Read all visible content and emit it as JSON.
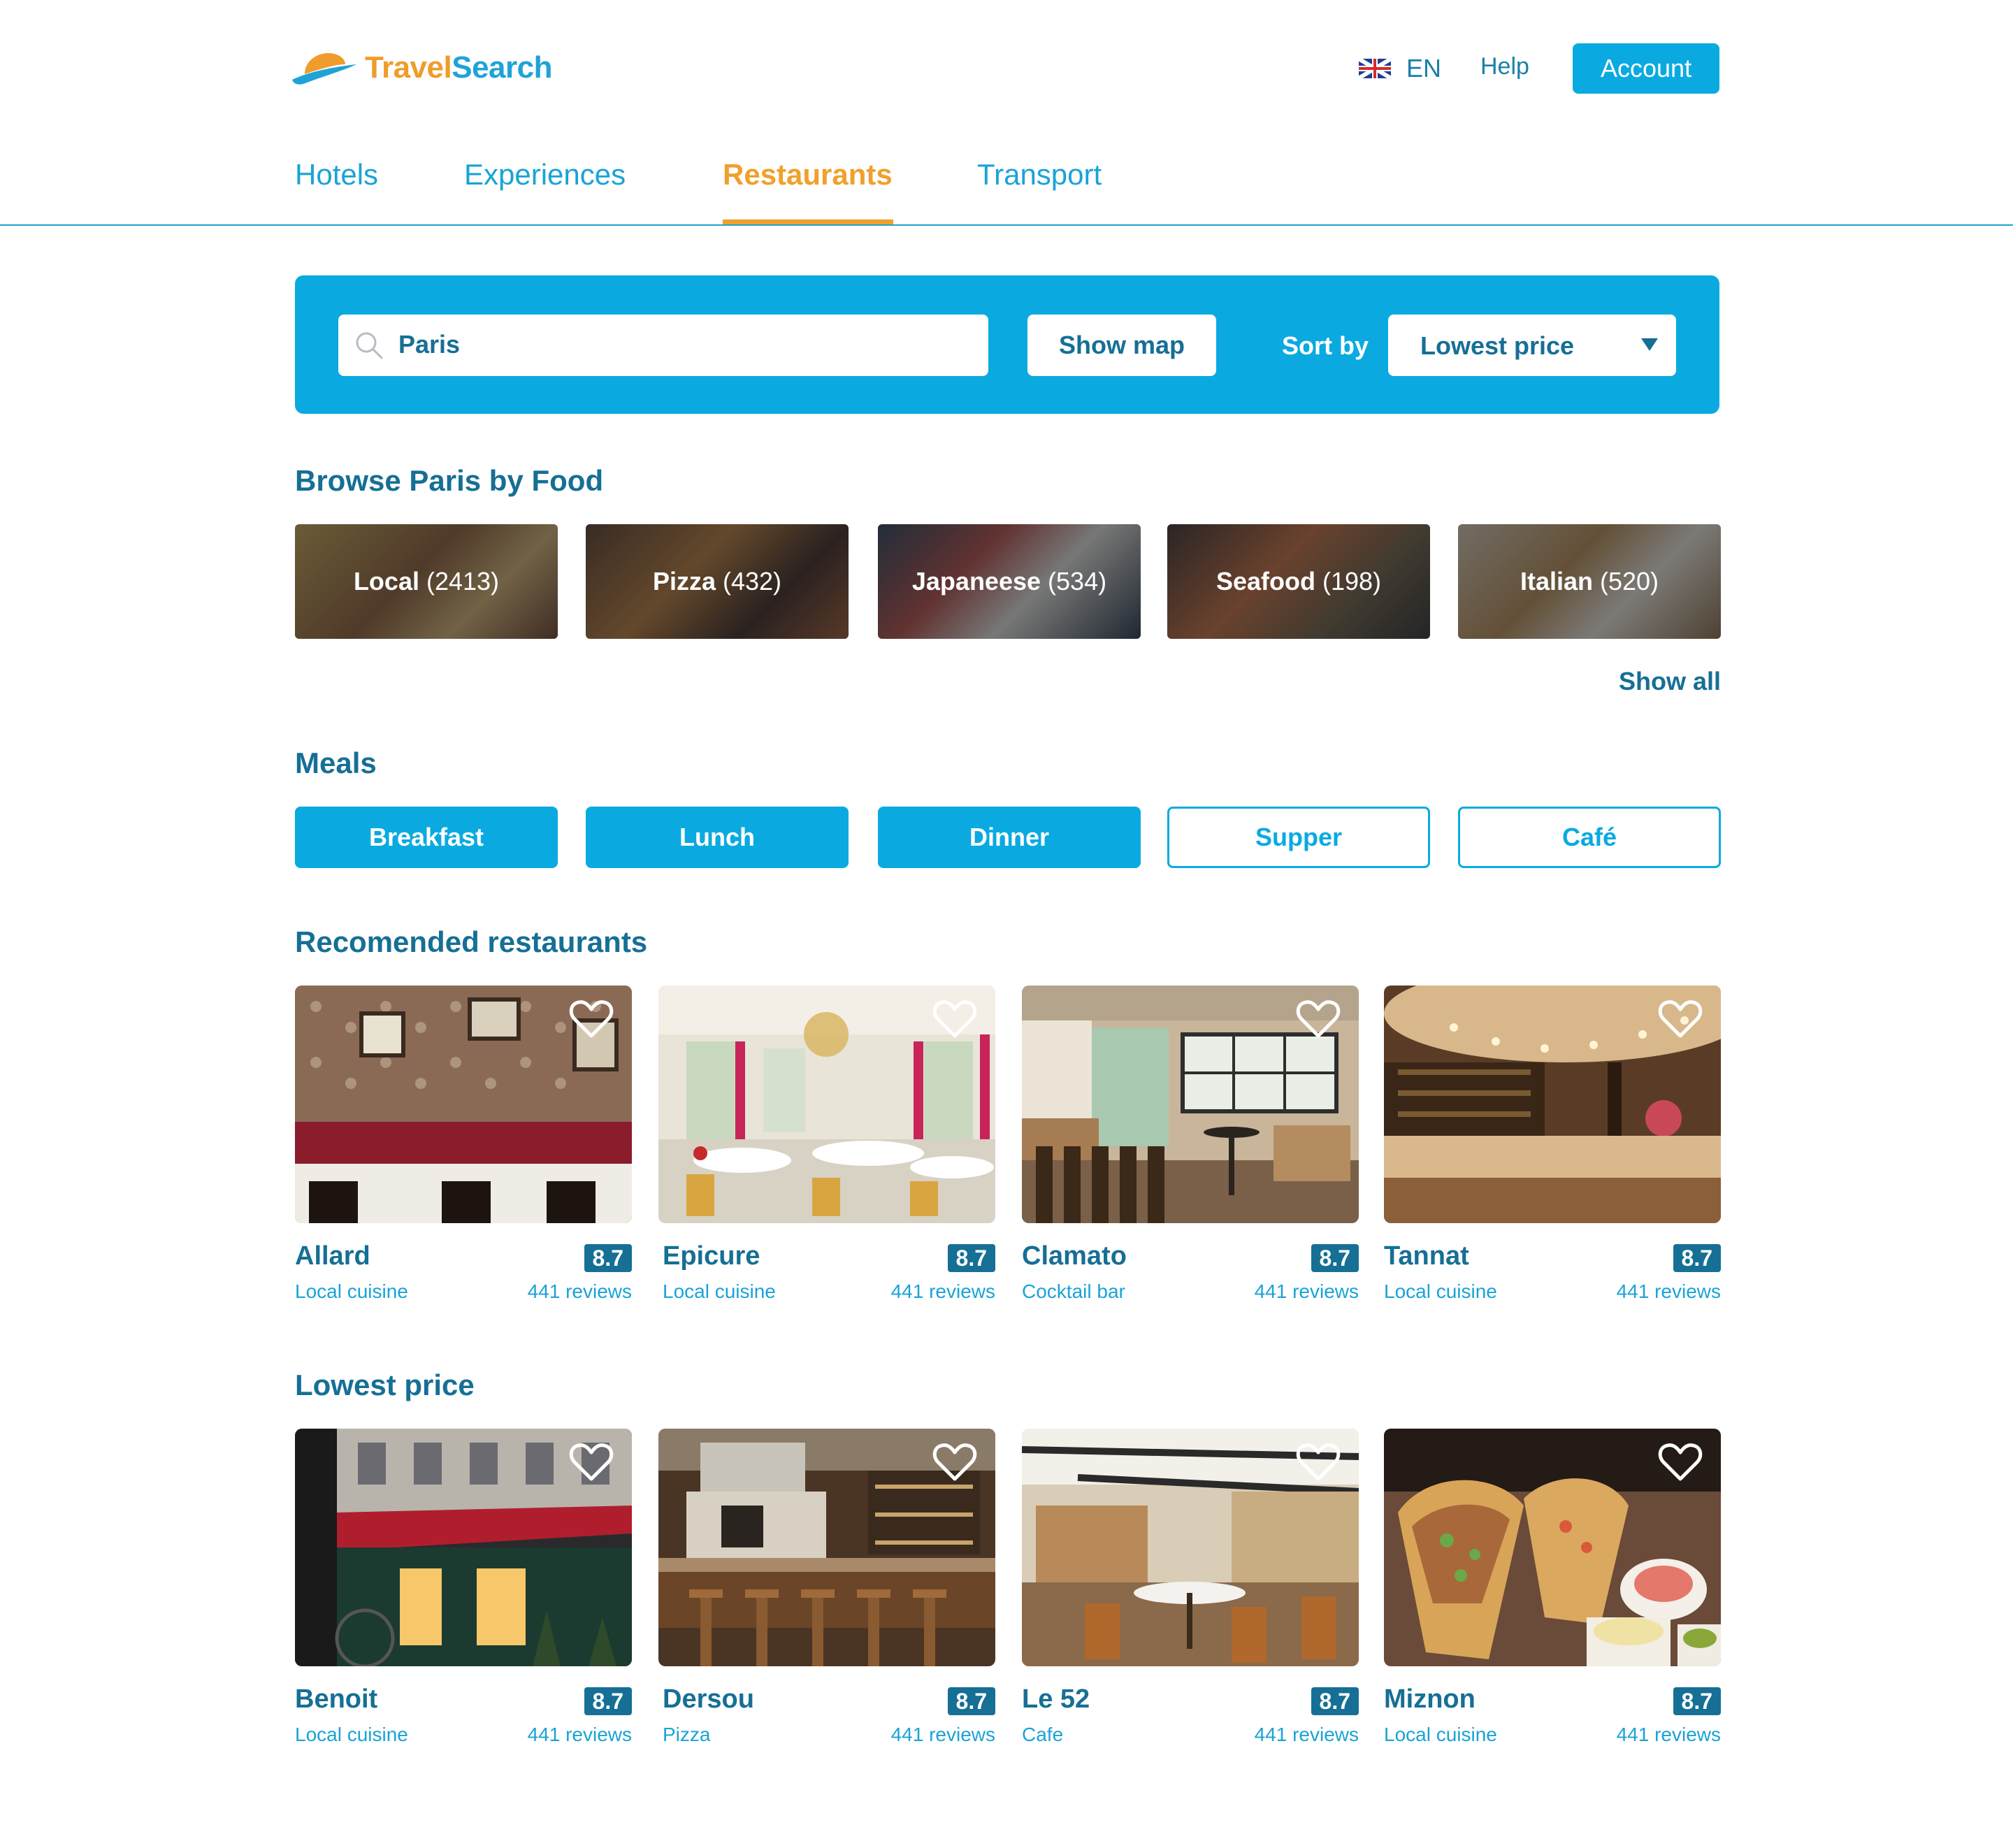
{
  "brand": {
    "name_part1": "Travel",
    "name_part2": "Search"
  },
  "header": {
    "language": "EN",
    "help": "Help",
    "account": "Account"
  },
  "tabs": [
    {
      "label": "Hotels"
    },
    {
      "label": "Experiences"
    },
    {
      "label": "Restaurants",
      "active": true
    },
    {
      "label": "Transport"
    }
  ],
  "search": {
    "value": "Paris",
    "show_map": "Show map",
    "sort_label": "Sort by",
    "sort_value": "Lowest price"
  },
  "food": {
    "title": "Browse Paris by Food",
    "items": [
      {
        "name": "Local",
        "count": "(2413)"
      },
      {
        "name": "Pizza",
        "count": "(432)"
      },
      {
        "name": "Japaneese",
        "count": "(534)"
      },
      {
        "name": "Seafood",
        "count": "(198)"
      },
      {
        "name": "Italian",
        "count": "(520)"
      }
    ],
    "show_all": "Show all"
  },
  "meals": {
    "title": "Meals",
    "items": [
      {
        "label": "Breakfast",
        "selected": true
      },
      {
        "label": "Lunch",
        "selected": true
      },
      {
        "label": "Dinner",
        "selected": true
      },
      {
        "label": "Supper",
        "selected": false
      },
      {
        "label": "Café",
        "selected": false
      }
    ]
  },
  "recommended": {
    "title": "Recomended restaurants",
    "items": [
      {
        "name": "Allard",
        "score": "8.7",
        "type": "Local cuisine",
        "reviews": "441 reviews"
      },
      {
        "name": "Epicure",
        "score": "8.7",
        "type": "Local cuisine",
        "reviews": "441 reviews"
      },
      {
        "name": "Clamato",
        "score": "8.7",
        "type": "Cocktail bar",
        "reviews": "441 reviews"
      },
      {
        "name": "Tannat",
        "score": "8.7",
        "type": "Local cuisine",
        "reviews": "441 reviews"
      }
    ]
  },
  "lowest": {
    "title": "Lowest price",
    "items": [
      {
        "name": "Benoit",
        "score": "8.7",
        "type": "Local cuisine",
        "reviews": "441 reviews"
      },
      {
        "name": "Dersou",
        "score": "8.7",
        "type": "Pizza",
        "reviews": "441 reviews"
      },
      {
        "name": "Le 52",
        "score": "8.7",
        "type": "Cafe",
        "reviews": "441 reviews"
      },
      {
        "name": "Miznon",
        "score": "8.7",
        "type": "Local cuisine",
        "reviews": "441 reviews"
      }
    ]
  },
  "colors": {
    "primary": "#0aaae1",
    "accent": "#f0a02c",
    "text_dark": "#166f95"
  },
  "icons": {
    "search": "search-icon",
    "favorite": "heart-icon",
    "language": "uk-flag-icon",
    "dropdown": "caret-down-icon"
  }
}
